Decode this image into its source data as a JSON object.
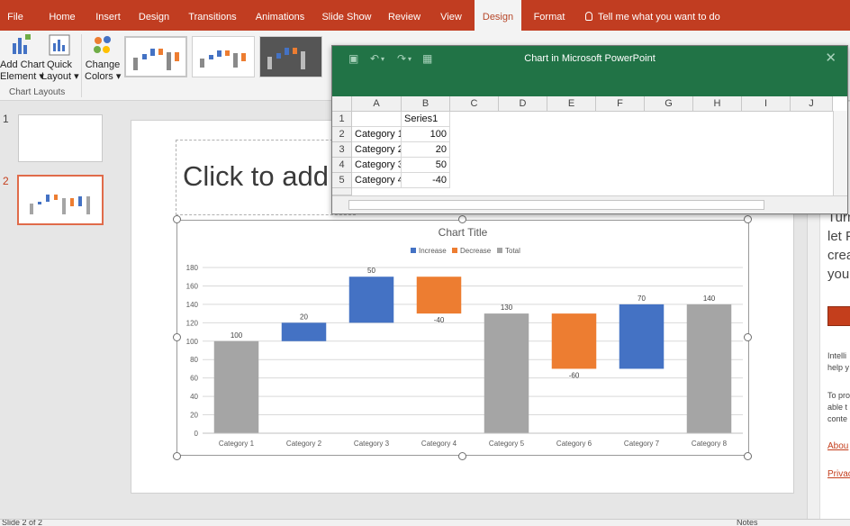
{
  "ribbon": {
    "tabs": [
      {
        "label": "File",
        "active": false
      },
      {
        "label": "Home",
        "active": false
      },
      {
        "label": "Insert",
        "active": false
      },
      {
        "label": "Design",
        "active": false
      },
      {
        "label": "Transitions",
        "active": false
      },
      {
        "label": "Animations",
        "active": false
      },
      {
        "label": "Slide Show",
        "active": false
      },
      {
        "label": "Review",
        "active": false
      },
      {
        "label": "View",
        "active": false
      },
      {
        "label": "Design",
        "active": true
      },
      {
        "label": "Format",
        "active": false
      }
    ],
    "tell_me": "Tell me what you want to do",
    "add_chart_element": {
      "line1": "Add Chart",
      "line2": "Element"
    },
    "quick_layout": {
      "line1": "Quick",
      "line2": "Layout"
    },
    "change_colors": {
      "line1": "Change",
      "line2": "Colors"
    },
    "group_label": "Chart Layouts",
    "accent_color": "#c13d21"
  },
  "slides_pane": {
    "slides": [
      {
        "number": "1",
        "selected": false
      },
      {
        "number": "2",
        "selected": true
      }
    ]
  },
  "slide": {
    "title_placeholder": "Click to add"
  },
  "spreadsheet": {
    "window_title": "Chart in Microsoft PowerPoint",
    "header_color": "#217346",
    "columns": [
      "A",
      "B",
      "C",
      "D",
      "E",
      "F",
      "G",
      "H",
      "I",
      "J"
    ],
    "rows": [
      {
        "row": "1",
        "a": "",
        "b": "Series1"
      },
      {
        "row": "2",
        "a": "Category 1",
        "b": "100"
      },
      {
        "row": "3",
        "a": "Category 2",
        "b": "20"
      },
      {
        "row": "4",
        "a": "Category 3",
        "b": "50"
      },
      {
        "row": "5",
        "a": "Category 4",
        "b": "-40"
      }
    ]
  },
  "task_pane": {
    "heading_lines": [
      "Turn",
      "let P",
      "crea",
      "you"
    ],
    "body_1": [
      "Intelli",
      "help y"
    ],
    "body_2": [
      "To pro",
      "able t",
      "conte"
    ],
    "link_about": "Abou",
    "link_privacy": "Privac"
  },
  "status_bar": {
    "slide_info": "Slide 2 of 2",
    "notes": "Notes"
  },
  "chart_data": {
    "type": "bar",
    "subtype": "waterfall",
    "title": "Chart Title",
    "legend": {
      "position": "top",
      "entries": [
        {
          "name": "Increase",
          "color": "#4472c4"
        },
        {
          "name": "Decrease",
          "color": "#ed7d31"
        },
        {
          "name": "Total",
          "color": "#a5a5a5"
        }
      ]
    },
    "categories": [
      "Category 1",
      "Category 2",
      "Category 3",
      "Category 4",
      "Category 5",
      "Category 6",
      "Category 7",
      "Category 8"
    ],
    "values": [
      100,
      20,
      50,
      -40,
      130,
      -60,
      70,
      140
    ],
    "kinds": [
      "total",
      "increase",
      "increase",
      "decrease",
      "total",
      "decrease",
      "increase",
      "total"
    ],
    "bar_labels": [
      "100",
      "20",
      "50",
      "-40",
      "130",
      "-60",
      "70",
      "140"
    ],
    "ylim": [
      0,
      180
    ],
    "yticks": [
      0,
      20,
      40,
      60,
      80,
      100,
      120,
      140,
      160,
      180
    ],
    "grid": true,
    "xlabel": "",
    "ylabel": ""
  }
}
